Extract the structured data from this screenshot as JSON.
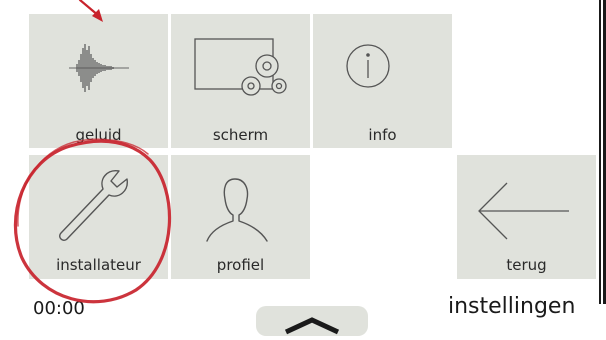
{
  "tiles": {
    "geluid": {
      "label": "geluid",
      "icon": "sound-wave-icon"
    },
    "scherm": {
      "label": "scherm",
      "icon": "screen-settings-icon"
    },
    "info": {
      "label": "info",
      "icon": "info-icon"
    },
    "installateur": {
      "label": "installateur",
      "icon": "wrench-icon"
    },
    "profiel": {
      "label": "profiel",
      "icon": "user-profile-icon"
    },
    "terug": {
      "label": "terug",
      "icon": "arrow-left-icon"
    }
  },
  "status": {
    "time": "00:00",
    "page_title": "instellingen"
  },
  "annotation": {
    "color": "#c8232c",
    "type": "red-circle-with-arrow"
  },
  "colors": {
    "tile_bg": "#e0e2dc",
    "icon_stroke": "#555555"
  }
}
